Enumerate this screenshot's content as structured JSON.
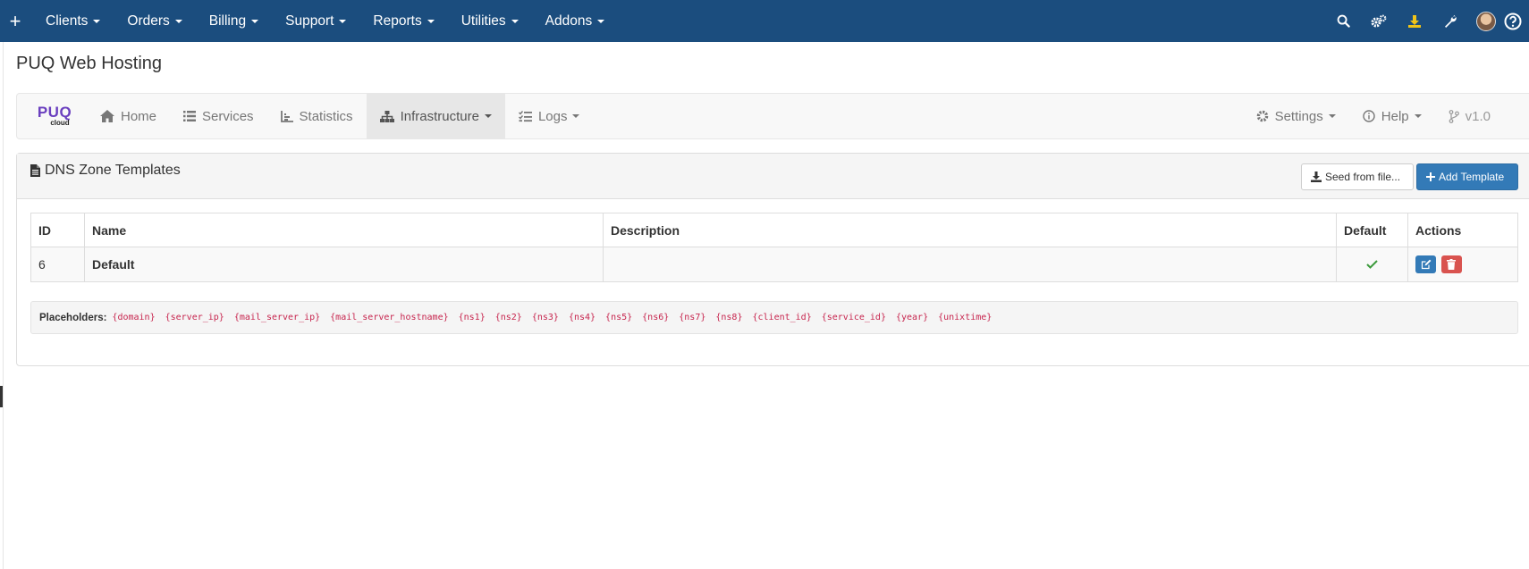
{
  "topbar": {
    "plus": "+",
    "menu": [
      {
        "label": "Clients"
      },
      {
        "label": "Orders"
      },
      {
        "label": "Billing"
      },
      {
        "label": "Support"
      },
      {
        "label": "Reports"
      },
      {
        "label": "Utilities"
      },
      {
        "label": "Addons"
      }
    ],
    "icons": [
      "search-icon",
      "cogs-icon",
      "download-icon",
      "wrench-icon",
      "avatar",
      "help-icon"
    ]
  },
  "page": {
    "title": "PUQ Web Hosting"
  },
  "modnav": {
    "brand_main": "PUQ",
    "brand_sub": "cloud",
    "items": [
      {
        "label": "Home",
        "icon": "home-icon"
      },
      {
        "label": "Services",
        "icon": "list-icon"
      },
      {
        "label": "Statistics",
        "icon": "chart-icon"
      },
      {
        "label": "Infrastructure",
        "icon": "sitemap-icon",
        "active": true
      },
      {
        "label": "Logs",
        "icon": "tasks-icon"
      }
    ],
    "right": [
      {
        "label": "Settings",
        "icon": "gear-icon"
      },
      {
        "label": "Help",
        "icon": "info-icon"
      },
      {
        "label": "v1.0",
        "icon": "branch-icon"
      }
    ]
  },
  "panel": {
    "title": "DNS Zone Templates",
    "seed_button": "Seed from file...",
    "add_button": "Add Template",
    "table": {
      "headers": [
        "ID",
        "Name",
        "Description",
        "Default",
        "Actions"
      ],
      "rows": [
        {
          "id": "6",
          "name": "Default",
          "description": "",
          "default": true
        }
      ]
    },
    "placeholders_label": "Placeholders:",
    "placeholders": [
      "{domain}",
      "{server_ip}",
      "{mail_server_ip}",
      "{mail_server_hostname}",
      "{ns1}",
      "{ns2}",
      "{ns3}",
      "{ns4}",
      "{ns5}",
      "{ns6}",
      "{ns7}",
      "{ns8}",
      "{client_id}",
      "{service_id}",
      "{year}",
      "{unixtime}"
    ]
  },
  "colors": {
    "topbar": "#1b4d7e",
    "primary": "#337ab7",
    "danger": "#d9534f",
    "success": "#3c9a3c",
    "code": "#c7254e",
    "brand": "#6a3fbf"
  }
}
